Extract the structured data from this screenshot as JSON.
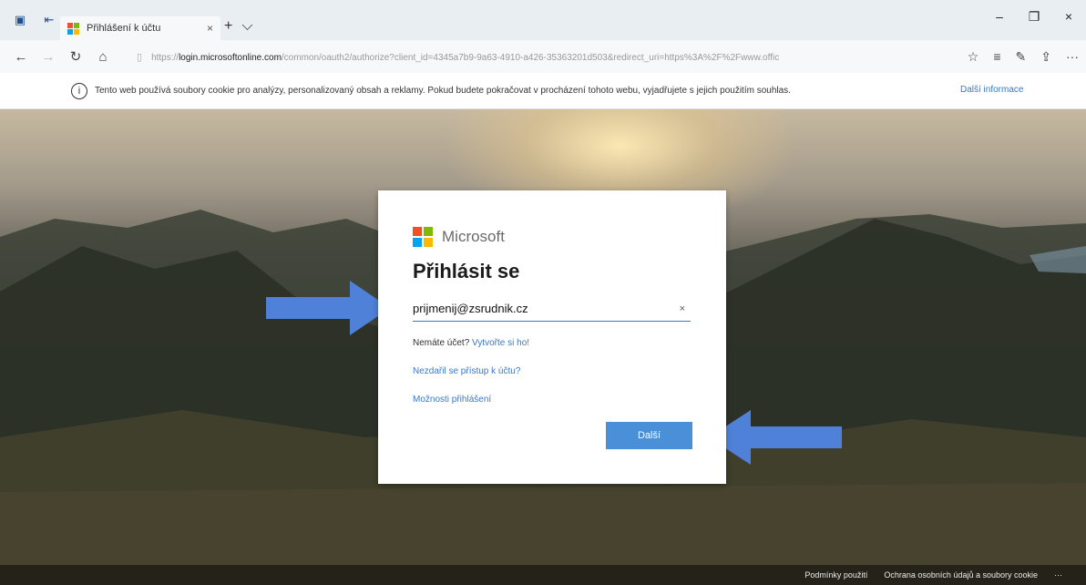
{
  "browser": {
    "tab_title": "Přihlášení k účtu",
    "url_prefix": "https://",
    "url_domain": "login.microsoftonline.com",
    "url_rest": "/common/oauth2/authorize?client_id=4345a7b9-9a63-4910-a426-35363201d503&redirect_uri=https%3A%2F%2Fwww.offic",
    "cookie_notice": "Tento web používá soubory cookie pro analýzy, personalizovaný obsah a reklamy. Pokud budete pokračovat v procházení tohoto webu, vyjadřujete s jejich použitím souhlas.",
    "cookie_more": "Další informace"
  },
  "login": {
    "brand": "Microsoft",
    "title": "Přihlásit se",
    "email_value": "prijmenij@zsrudnik.cz",
    "clear_symbol": "×",
    "no_account_text": "Nemáte účet?",
    "create_account_link": "Vytvořte si ho!",
    "cant_access_link": "Nezdařil se přístup k účtu?",
    "signin_options_link": "Možnosti přihlášení",
    "next_button": "Další"
  },
  "footer": {
    "terms": "Podmínky použití",
    "privacy": "Ochrana osobních údajů a soubory cookie",
    "more": "···"
  },
  "colors": {
    "accent": "#4a90d9",
    "link": "#3a78c9",
    "arrow": "#4f81d9"
  },
  "icons": {
    "back": "←",
    "forward": "→",
    "refresh": "↻",
    "home": "⌂",
    "favorite": "☆",
    "hub": "≡",
    "pen": "✎",
    "share": "⇪",
    "more": "···",
    "minimize": "–",
    "restore": "❐",
    "close": "×",
    "new_tab": "+",
    "tab_menu": "⌵",
    "info": "i"
  }
}
